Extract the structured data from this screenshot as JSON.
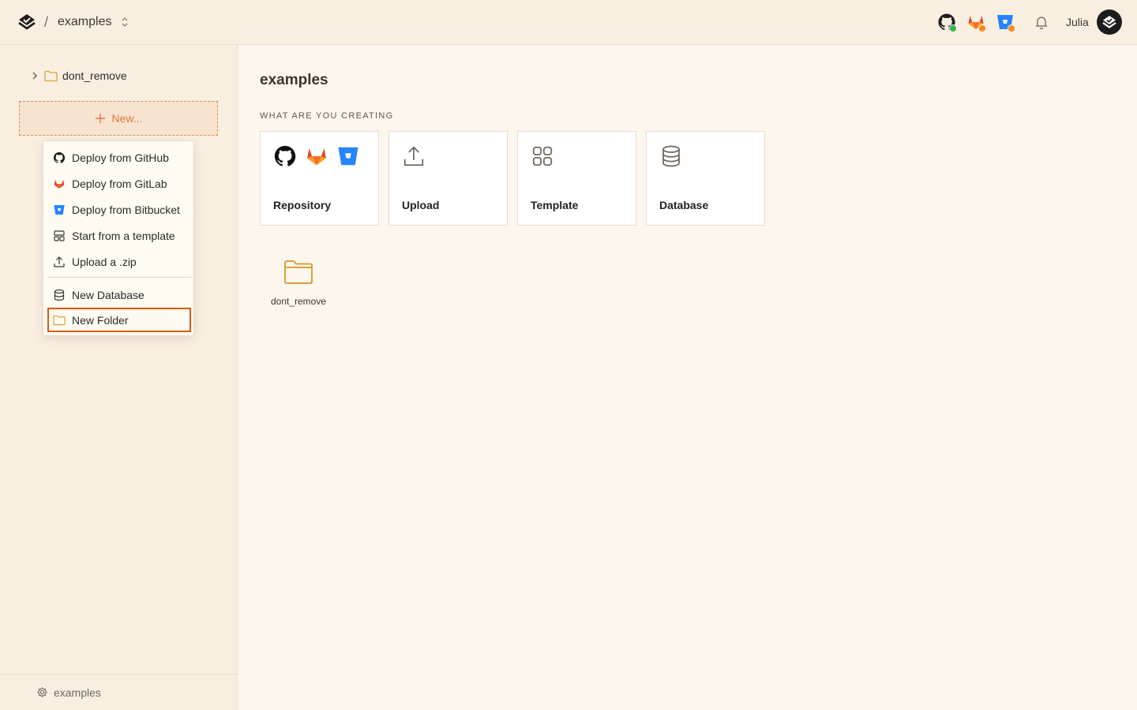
{
  "header": {
    "separator": "/",
    "project_name": "examples",
    "username": "Julia",
    "status_colors": {
      "github": "#2fb84a",
      "gitlab": "#f08a24",
      "bitbucket": "#f08a24"
    }
  },
  "sidebar": {
    "tree": [
      {
        "label": "dont_remove"
      }
    ],
    "new_button_label": "New...",
    "footer_label": "examples"
  },
  "menu": {
    "items": [
      {
        "label": "Deploy from GitHub",
        "icon": "github-icon"
      },
      {
        "label": "Deploy from GitLab",
        "icon": "gitlab-icon"
      },
      {
        "label": "Deploy from Bitbucket",
        "icon": "bitbucket-icon"
      },
      {
        "label": "Start from a template",
        "icon": "template-icon"
      },
      {
        "label": "Upload a .zip",
        "icon": "upload-icon"
      },
      {
        "label": "New Database",
        "icon": "database-icon"
      },
      {
        "label": "New Folder",
        "icon": "folder-icon",
        "selected": true
      }
    ]
  },
  "main": {
    "title": "examples",
    "section_label": "WHAT ARE YOU CREATING",
    "cards": [
      {
        "label": "Repository",
        "icon": "repository-icons"
      },
      {
        "label": "Upload",
        "icon": "upload-icon"
      },
      {
        "label": "Template",
        "icon": "template-grid-icon"
      },
      {
        "label": "Database",
        "icon": "database-icon"
      }
    ],
    "folders": [
      {
        "label": "dont_remove"
      }
    ]
  },
  "colors": {
    "accent": "#e07a3c",
    "selected_border": "#d65a12",
    "folder": "#d9a23a",
    "gitlab": "#e2432a",
    "bitbucket": "#2684ff"
  }
}
